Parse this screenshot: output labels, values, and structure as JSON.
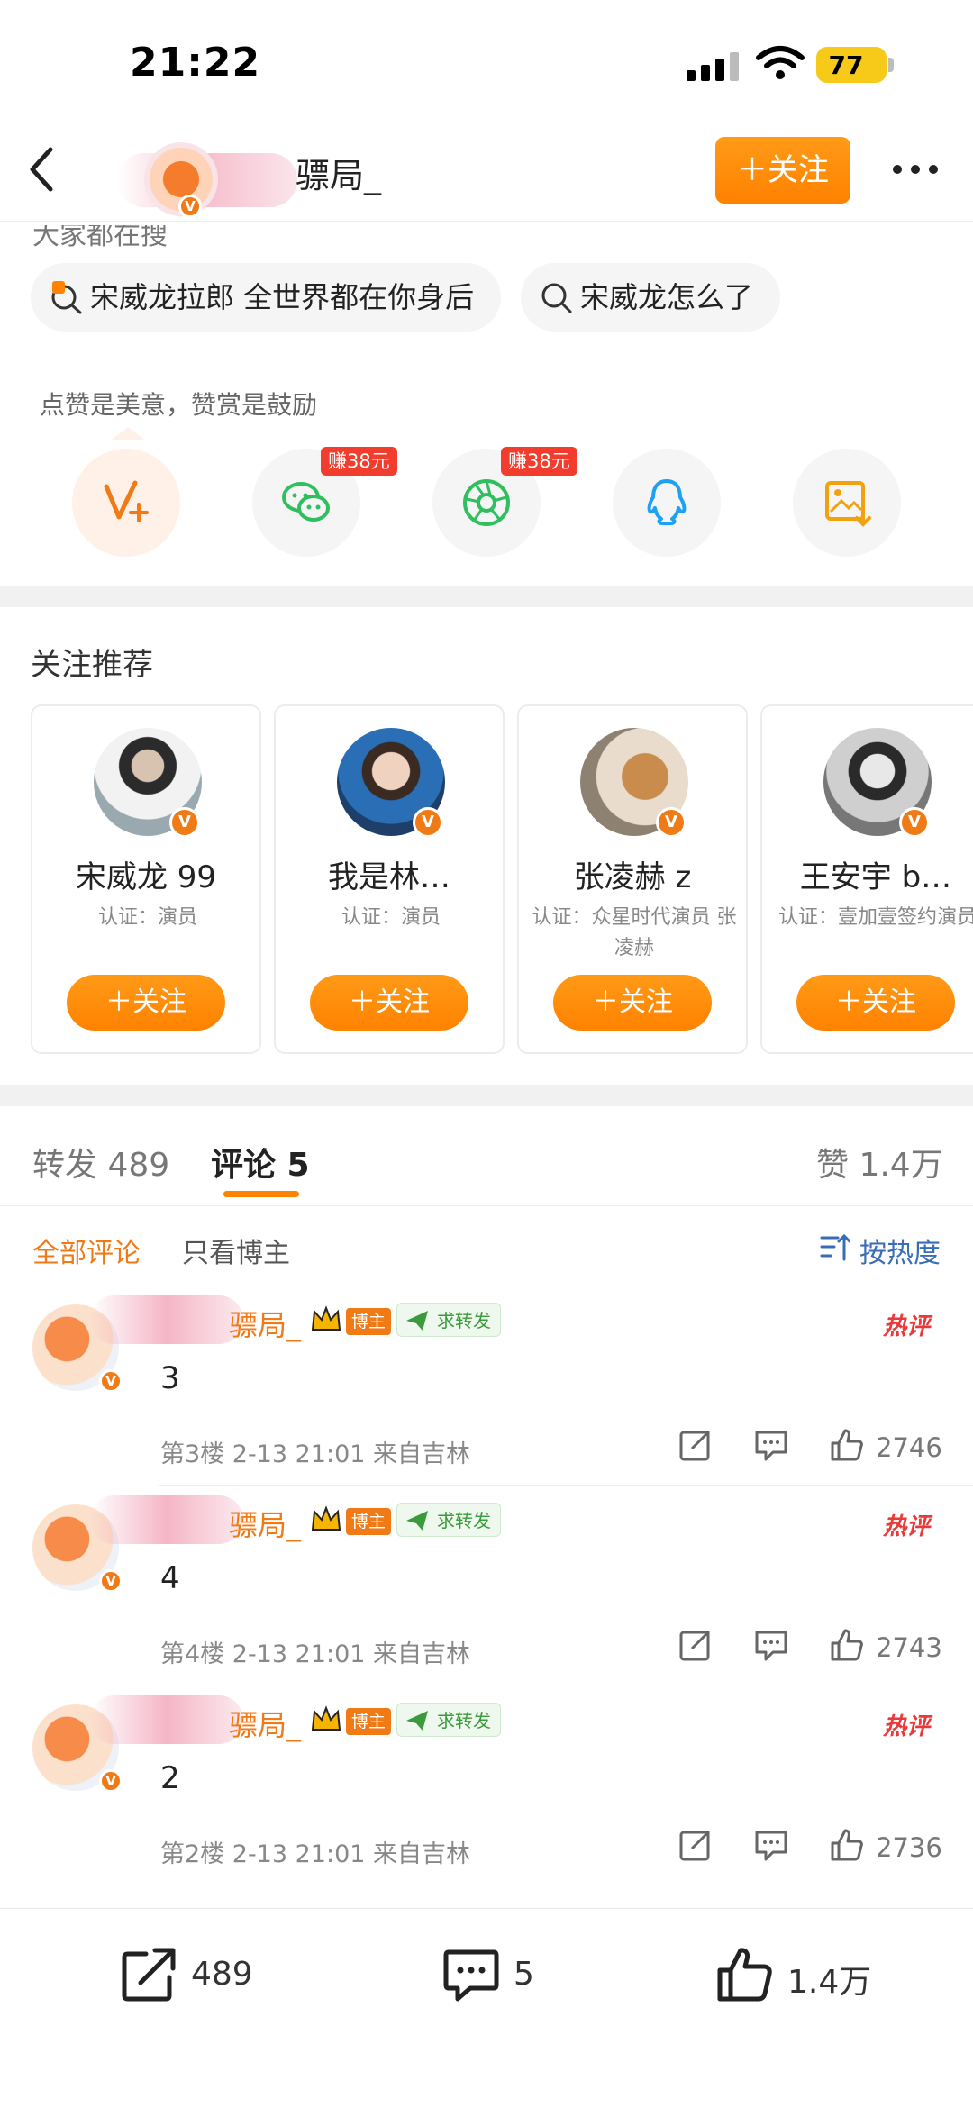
{
  "status_bar": {
    "time": "21:22",
    "battery": "77"
  },
  "header": {
    "title_suffix": "骠局_",
    "follow_label": "＋关注"
  },
  "hot_searches": {
    "label": "大家都在搜",
    "items": [
      "宋威龙拉郎 全世界都在你身后",
      "宋威龙怎么了"
    ]
  },
  "share": {
    "hint": "点赞是美意，赞赏是鼓励",
    "earn_label": "赚38元",
    "icons": [
      "v-plus-icon",
      "wechat-icon",
      "moments-icon",
      "qq-icon",
      "save-image-icon"
    ]
  },
  "recommend": {
    "title": "关注推荐",
    "follow_label": "＋关注",
    "cards": [
      {
        "name": "宋威龙 99",
        "cert": "认证：演员"
      },
      {
        "name": "我是林…",
        "cert": "认证：演员"
      },
      {
        "name": "张凌赫 z",
        "cert": "认证：众星时代演员 张凌赫"
      },
      {
        "name": "王安宇 b…",
        "cert": "认证：壹加壹签约演员"
      }
    ]
  },
  "tabs": {
    "repost": "转发 489",
    "comments": "评论 5",
    "likes": "赞 1.4万"
  },
  "filters": {
    "all": "全部评论",
    "blogger_only": "只看博主",
    "sort": "按热度"
  },
  "comments": [
    {
      "name": "骠局_",
      "badge": "博主",
      "repost_tag": "求转发",
      "hot": "热评",
      "text": "3",
      "meta": "第3楼  2-13 21:01  来自吉林",
      "likes": "2746"
    },
    {
      "name": "骠局_",
      "badge": "博主",
      "repost_tag": "求转发",
      "hot": "热评",
      "text": "4",
      "meta": "第4楼  2-13 21:01  来自吉林",
      "likes": "2743"
    },
    {
      "name": "骠局_",
      "badge": "博主",
      "repost_tag": "求转发",
      "hot": "热评",
      "text": "2",
      "meta": "第2楼  2-13 21:01  来自吉林",
      "likes": "2736"
    }
  ],
  "bottom_bar": {
    "reposts": "489",
    "comments": "5",
    "likes": "1.4万"
  },
  "colors": {
    "accent": "#ff8200",
    "hot": "#e83a3a",
    "earn": "#f23c2d",
    "repost_green": "#3a9b3a"
  }
}
